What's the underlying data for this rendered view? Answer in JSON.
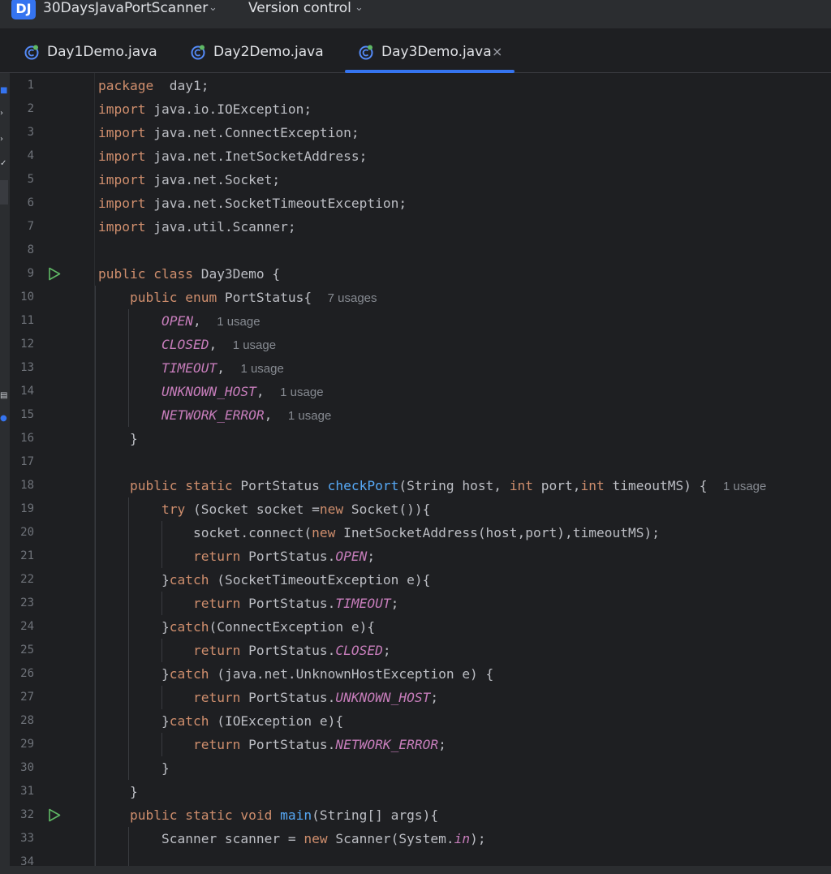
{
  "titlebar": {
    "project_badge": "DJ",
    "project_name": "30DaysJavaPortScanner",
    "vcs_label": "Version control",
    "chevron_icon": "chevron-down-icon"
  },
  "tabs": [
    {
      "label": "Day1Demo.java",
      "icon": "java-class-icon",
      "active": false
    },
    {
      "label": "Day2Demo.java",
      "icon": "java-class-icon",
      "active": false
    },
    {
      "label": "Day3Demo.java",
      "icon": "java-class-icon",
      "active": true,
      "close": "×"
    }
  ],
  "colors": {
    "accent": "#3574f0",
    "keyword": "#cf8e6d",
    "function": "#56a8f5",
    "constant": "#c77dbb",
    "text": "#bcbec4",
    "hint": "#868a91",
    "background": "#1e1f22",
    "run_icon": "#5fb865"
  },
  "editor": {
    "run_gutter_lines": [
      9,
      32
    ],
    "lines": [
      {
        "n": "1",
        "tokens": [
          [
            "kw",
            "package"
          ],
          [
            "",
            "  day1;"
          ]
        ]
      },
      {
        "n": "2",
        "tokens": [
          [
            "kw",
            "import"
          ],
          [
            "",
            " java.io.IOException;"
          ]
        ]
      },
      {
        "n": "3",
        "tokens": [
          [
            "kw",
            "import"
          ],
          [
            "",
            " java.net.ConnectException;"
          ]
        ]
      },
      {
        "n": "4",
        "tokens": [
          [
            "kw",
            "import"
          ],
          [
            "",
            " java.net.InetSocketAddress;"
          ]
        ]
      },
      {
        "n": "5",
        "tokens": [
          [
            "kw",
            "import"
          ],
          [
            "",
            " java.net.Socket;"
          ]
        ]
      },
      {
        "n": "6",
        "tokens": [
          [
            "kw",
            "import"
          ],
          [
            "",
            " java.net.SocketTimeoutException;"
          ]
        ]
      },
      {
        "n": "7",
        "tokens": [
          [
            "kw",
            "import"
          ],
          [
            "",
            " java.util.Scanner;"
          ]
        ]
      },
      {
        "n": "8",
        "tokens": []
      },
      {
        "n": "9",
        "tokens": [
          [
            "kw",
            "public class"
          ],
          [
            "",
            " Day3Demo {"
          ]
        ]
      },
      {
        "n": "10",
        "tokens": [
          [
            "",
            "    "
          ],
          [
            "kw",
            "public enum"
          ],
          [
            "",
            " PortStatus{  "
          ],
          [
            "hint",
            "7 usages"
          ]
        ]
      },
      {
        "n": "11",
        "tokens": [
          [
            "",
            "        "
          ],
          [
            "cst",
            "OPEN"
          ],
          [
            "",
            ",  "
          ],
          [
            "hint",
            "1 usage"
          ]
        ]
      },
      {
        "n": "12",
        "tokens": [
          [
            "",
            "        "
          ],
          [
            "cst",
            "CLOSED"
          ],
          [
            "",
            ",  "
          ],
          [
            "hint",
            "1 usage"
          ]
        ]
      },
      {
        "n": "13",
        "tokens": [
          [
            "",
            "        "
          ],
          [
            "cst",
            "TIMEOUT"
          ],
          [
            "",
            ",  "
          ],
          [
            "hint",
            "1 usage"
          ]
        ]
      },
      {
        "n": "14",
        "tokens": [
          [
            "",
            "        "
          ],
          [
            "cst",
            "UNKNOWN_HOST"
          ],
          [
            "",
            ",  "
          ],
          [
            "hint",
            "1 usage"
          ]
        ]
      },
      {
        "n": "15",
        "tokens": [
          [
            "",
            "        "
          ],
          [
            "cst",
            "NETWORK_ERROR"
          ],
          [
            "",
            ",  "
          ],
          [
            "hint",
            "1 usage"
          ]
        ]
      },
      {
        "n": "16",
        "tokens": [
          [
            "",
            "    }"
          ]
        ]
      },
      {
        "n": "17",
        "tokens": []
      },
      {
        "n": "18",
        "tokens": [
          [
            "",
            "    "
          ],
          [
            "kw",
            "public static"
          ],
          [
            "",
            " PortStatus "
          ],
          [
            "fn",
            "checkPort"
          ],
          [
            "",
            "(String host, "
          ],
          [
            "kw",
            "int"
          ],
          [
            "",
            " port,"
          ],
          [
            "kw",
            "int"
          ],
          [
            "",
            " timeoutMS) {  "
          ],
          [
            "hint",
            "1 usage"
          ]
        ]
      },
      {
        "n": "19",
        "tokens": [
          [
            "",
            "        "
          ],
          [
            "kw",
            "try"
          ],
          [
            "",
            " (Socket socket ="
          ],
          [
            "kw",
            "new"
          ],
          [
            "",
            " Socket()){"
          ]
        ]
      },
      {
        "n": "20",
        "tokens": [
          [
            "",
            "            socket.connect("
          ],
          [
            "kw",
            "new"
          ],
          [
            "",
            " InetSocketAddress(host,port),timeoutMS);"
          ]
        ]
      },
      {
        "n": "21",
        "tokens": [
          [
            "",
            "            "
          ],
          [
            "kw",
            "return"
          ],
          [
            "",
            " PortStatus."
          ],
          [
            "cst",
            "OPEN"
          ],
          [
            "",
            ";"
          ]
        ]
      },
      {
        "n": "22",
        "tokens": [
          [
            "",
            "        }"
          ],
          [
            "kw",
            "catch"
          ],
          [
            "",
            " (SocketTimeoutException e){"
          ]
        ]
      },
      {
        "n": "23",
        "tokens": [
          [
            "",
            "            "
          ],
          [
            "kw",
            "return"
          ],
          [
            "",
            " PortStatus."
          ],
          [
            "cst",
            "TIMEOUT"
          ],
          [
            "",
            ";"
          ]
        ]
      },
      {
        "n": "24",
        "tokens": [
          [
            "",
            "        }"
          ],
          [
            "kw",
            "catch"
          ],
          [
            "",
            "(ConnectException e){"
          ]
        ]
      },
      {
        "n": "25",
        "tokens": [
          [
            "",
            "            "
          ],
          [
            "kw",
            "return"
          ],
          [
            "",
            " PortStatus."
          ],
          [
            "cst",
            "CLOSED"
          ],
          [
            "",
            ";"
          ]
        ]
      },
      {
        "n": "26",
        "tokens": [
          [
            "",
            "        }"
          ],
          [
            "kw",
            "catch"
          ],
          [
            "",
            " (java.net.UnknownHostException e) {"
          ]
        ]
      },
      {
        "n": "27",
        "tokens": [
          [
            "",
            "            "
          ],
          [
            "kw",
            "return"
          ],
          [
            "",
            " PortStatus."
          ],
          [
            "cst",
            "UNKNOWN_HOST"
          ],
          [
            "",
            ";"
          ]
        ]
      },
      {
        "n": "28",
        "tokens": [
          [
            "",
            "        }"
          ],
          [
            "kw",
            "catch"
          ],
          [
            "",
            " (IOException e){"
          ]
        ]
      },
      {
        "n": "29",
        "tokens": [
          [
            "",
            "            "
          ],
          [
            "kw",
            "return"
          ],
          [
            "",
            " PortStatus."
          ],
          [
            "cst",
            "NETWORK_ERROR"
          ],
          [
            "",
            ";"
          ]
        ]
      },
      {
        "n": "30",
        "tokens": [
          [
            "",
            "        }"
          ]
        ]
      },
      {
        "n": "31",
        "tokens": [
          [
            "",
            "    }"
          ]
        ]
      },
      {
        "n": "32",
        "tokens": [
          [
            "",
            "    "
          ],
          [
            "kw",
            "public static void"
          ],
          [
            "",
            " "
          ],
          [
            "fn",
            "main"
          ],
          [
            "",
            "(String[] args){"
          ]
        ]
      },
      {
        "n": "33",
        "tokens": [
          [
            "",
            "        Scanner scanner = "
          ],
          [
            "kw",
            "new"
          ],
          [
            "",
            " Scanner(System."
          ],
          [
            "cst",
            "in"
          ],
          [
            "",
            ");"
          ]
        ]
      },
      {
        "n": "34",
        "tokens": []
      }
    ]
  }
}
